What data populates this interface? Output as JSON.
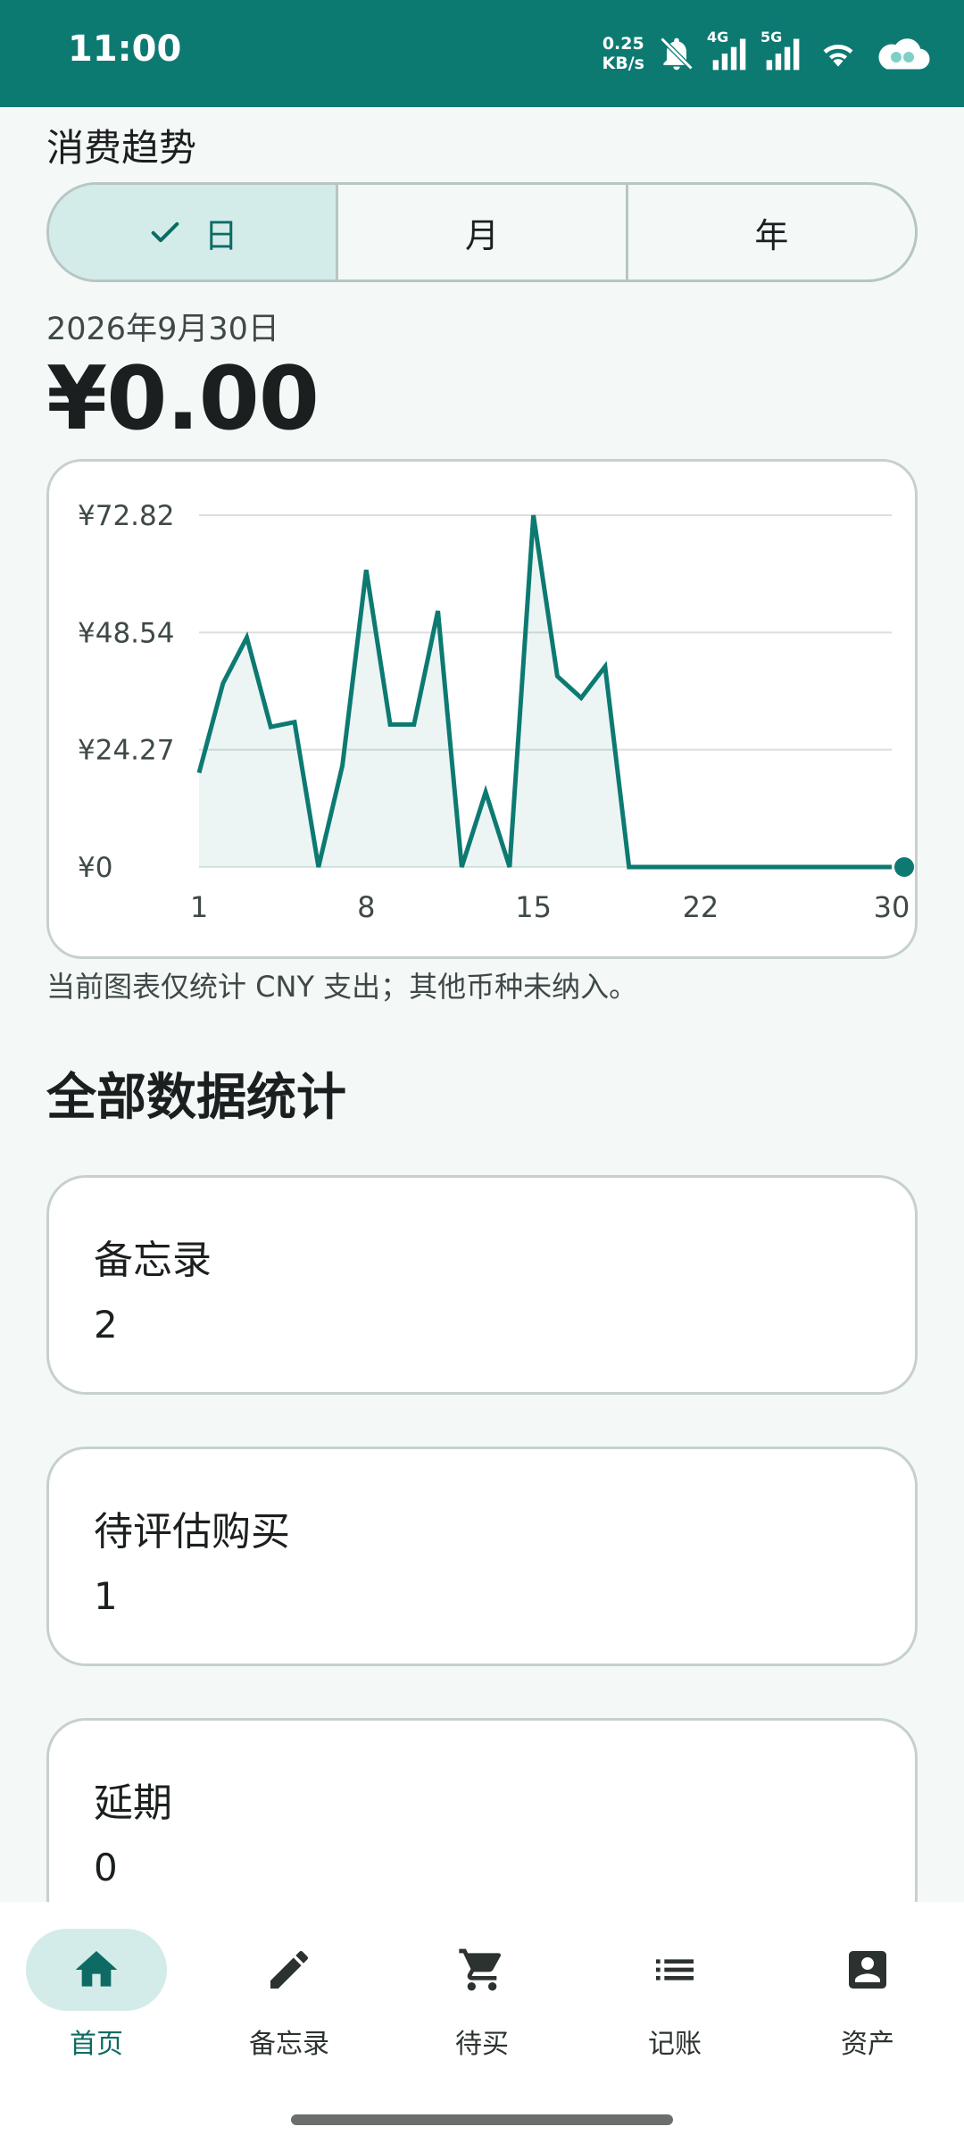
{
  "status_bar": {
    "time": "11:00",
    "net_speed_value": "0.25",
    "net_speed_unit": "KB/s",
    "network_4g": "4G",
    "network_5g": "5G",
    "icons": [
      "mute-bell-icon",
      "signal-4g-icon",
      "signal-5g-icon",
      "wifi-icon",
      "cloud-icon"
    ]
  },
  "trend": {
    "title": "消费趋势",
    "segments": [
      {
        "label": "日",
        "selected": true
      },
      {
        "label": "月",
        "selected": false
      },
      {
        "label": "年",
        "selected": false
      }
    ],
    "date": "2026年9月30日",
    "amount": "¥0.00",
    "note": "当前图表仅统计 CNY 支出；其他币种未纳入。"
  },
  "chart_data": {
    "type": "area",
    "title": "",
    "xlabel": "",
    "ylabel": "",
    "x_ticks": [
      "1",
      "8",
      "15",
      "22",
      "30"
    ],
    "y_ticks": [
      "¥72.82",
      "¥48.54",
      "¥24.27",
      "¥0"
    ],
    "ylim": [
      0,
      72.82
    ],
    "xlim": [
      1,
      30
    ],
    "grid": true,
    "line_color": "#0d7a72",
    "series": [
      {
        "x": [
          1,
          2,
          3,
          4,
          5,
          6,
          7,
          8,
          9,
          10,
          11,
          12,
          13,
          14,
          15,
          16,
          17,
          18,
          19,
          20,
          21,
          22,
          23,
          24,
          25,
          26,
          27,
          28,
          29,
          30
        ],
        "values": [
          19.5,
          38,
          47.5,
          29,
          30,
          0,
          21,
          61.5,
          29.5,
          29.5,
          53,
          0,
          15.5,
          0,
          72.82,
          39.5,
          35,
          41.5,
          0,
          0,
          0,
          0,
          0,
          0,
          0,
          0,
          0,
          0,
          0,
          0
        ]
      }
    ],
    "highlight_point": {
      "x": 30,
      "y": 0
    }
  },
  "stats": {
    "title": "全部数据统计",
    "cards": [
      {
        "label": "备忘录",
        "value": "2"
      },
      {
        "label": "待评估购买",
        "value": "1"
      },
      {
        "label": "延期",
        "value": "0"
      }
    ]
  },
  "bottom_nav": {
    "items": [
      {
        "label": "首页",
        "icon": "home-icon",
        "active": true
      },
      {
        "label": "备忘录",
        "icon": "pencil-icon",
        "active": false
      },
      {
        "label": "待买",
        "icon": "cart-icon",
        "active": false
      },
      {
        "label": "记账",
        "icon": "list-icon",
        "active": false
      },
      {
        "label": "资产",
        "icon": "account-box-icon",
        "active": false
      }
    ]
  },
  "colors": {
    "primary": "#0d7a72",
    "selected_bg": "#d3ecea",
    "background": "#f4f9f8"
  }
}
